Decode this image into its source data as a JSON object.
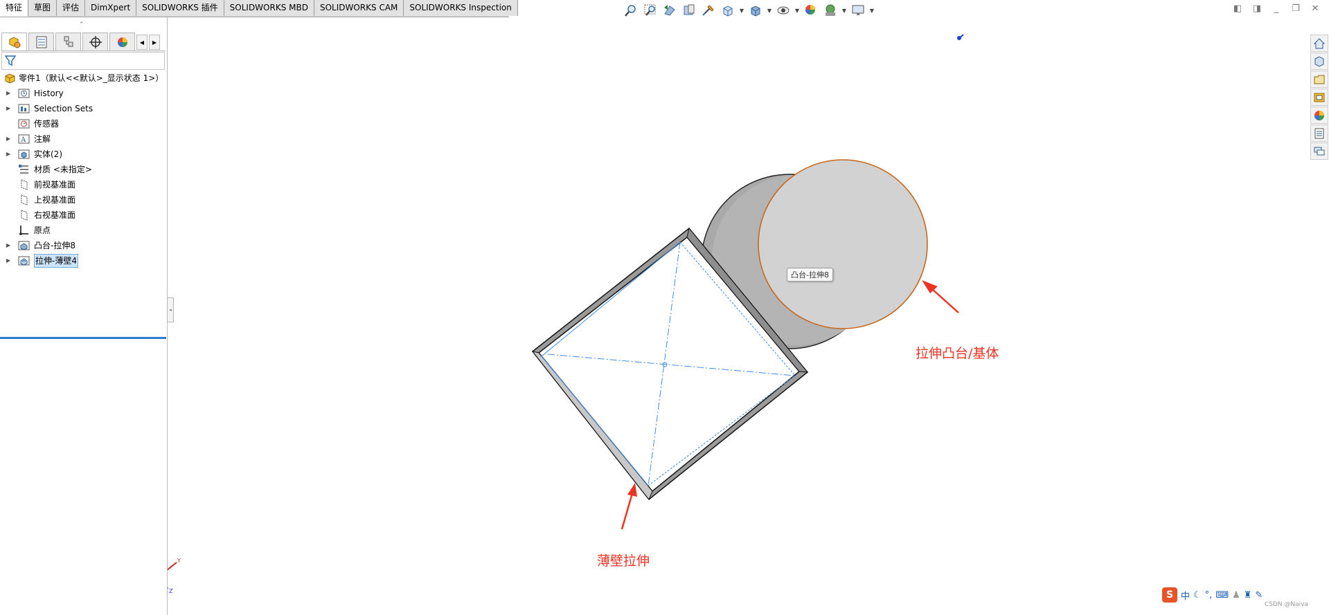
{
  "command_tabs": [
    {
      "label": "特征",
      "active": true
    },
    {
      "label": "草图"
    },
    {
      "label": "评估"
    },
    {
      "label": "DimXpert"
    },
    {
      "label": "SOLIDWORKS 插件"
    },
    {
      "label": "SOLIDWORKS MBD"
    },
    {
      "label": "SOLIDWORKS CAM"
    },
    {
      "label": "SOLIDWORKS Inspection"
    }
  ],
  "hud_icons": [
    "zoom-to-fit-icon",
    "zoom-area-icon",
    "previous-view-icon",
    "section-view-icon",
    "dynamic-annotation-icon",
    "view-orientation-icon",
    "display-style-icon",
    "hide-show-icon",
    "edit-appearance-icon",
    "apply-scene-icon",
    "view-settings-icon"
  ],
  "feature_tree": {
    "root": "零件1（默认<<默认>_显示状态 1>）",
    "items": [
      {
        "label": "History",
        "expandable": true,
        "icon": "history-folder-icon"
      },
      {
        "label": "Selection Sets",
        "expandable": true,
        "icon": "selection-sets-icon"
      },
      {
        "label": "传感器",
        "expandable": false,
        "icon": "sensor-icon"
      },
      {
        "label": "注解",
        "expandable": true,
        "icon": "annotations-icon"
      },
      {
        "label": "实体(2)",
        "expandable": true,
        "icon": "solid-bodies-icon"
      },
      {
        "label": "材质 <未指定>",
        "expandable": false,
        "icon": "material-icon"
      },
      {
        "label": "前视基准面",
        "expandable": false,
        "icon": "plane-icon"
      },
      {
        "label": "上视基准面",
        "expandable": false,
        "icon": "plane-icon"
      },
      {
        "label": "右视基准面",
        "expandable": false,
        "icon": "plane-icon"
      },
      {
        "label": "原点",
        "expandable": false,
        "icon": "origin-icon"
      },
      {
        "label": "凸台-拉伸8",
        "expandable": true,
        "icon": "boss-extrude-icon"
      },
      {
        "label": "拉伸-薄壁4",
        "expandable": true,
        "icon": "thin-extrude-icon",
        "selected": true
      }
    ]
  },
  "graphics": {
    "tooltip": "凸台-拉伸8",
    "annotation_boss": "拉伸凸台/基体",
    "annotation_thin": "薄壁拉伸"
  },
  "ime": {
    "logo": "S",
    "mode": "中"
  },
  "watermark": "CSDN @Naiva",
  "colors": {
    "annotation_red": "#ee3322",
    "edge_orange": "#c8661a",
    "selection_blue": "#2b7ad1",
    "sketch_line": "#3d8de0"
  }
}
